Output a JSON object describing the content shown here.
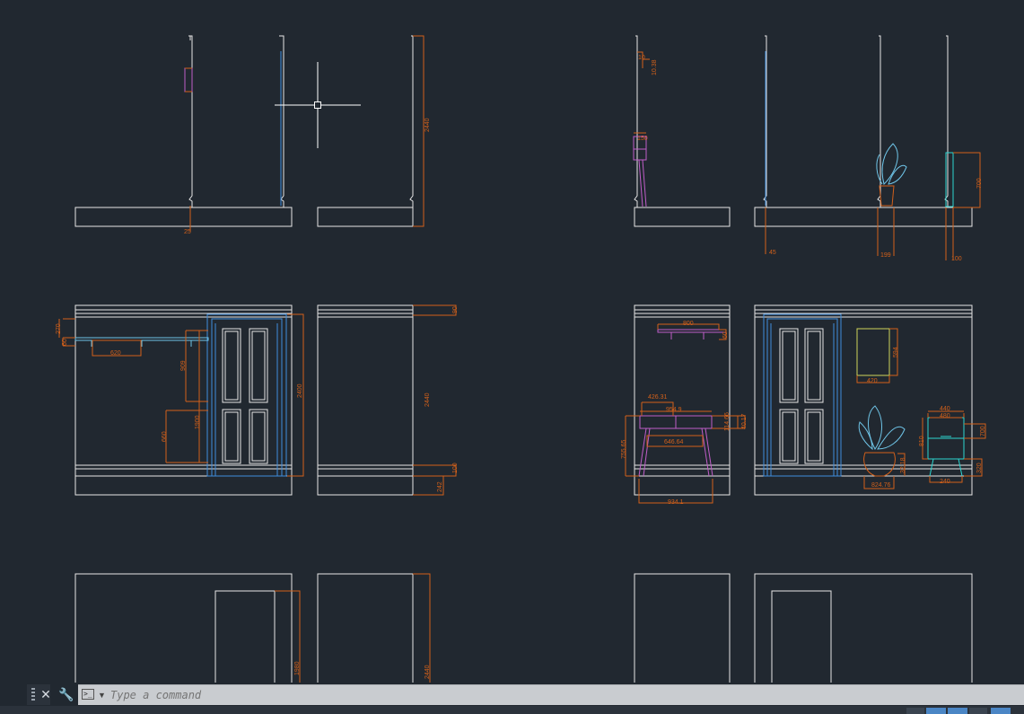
{
  "colors": {
    "background": "#212830",
    "wall_lines": "#e6e6e6",
    "dimensions": "#d2601a",
    "door": "#3e8ede",
    "furniture": "#c05ec8",
    "plant": "#6fc5e8",
    "cabinet": "#2dd6d0",
    "picture": "#cfd55a"
  },
  "dimensions": {
    "top_left": {
      "height": "2440",
      "base": "25"
    },
    "top_right": {
      "h150": "150",
      "h45": "45",
      "h199": "199",
      "h100": "100",
      "h700": "700",
      "s10": "10",
      "s1038": "10.38"
    },
    "mid_left": {
      "d270": "270",
      "d60": "60",
      "d620": "620",
      "d909": "909",
      "d1900": "1900",
      "d660": "660",
      "d2400": "2400",
      "d2440": "2440",
      "d90": "90",
      "d100": "100",
      "d242": "242"
    },
    "mid_right": {
      "d800": "800",
      "d60": "60",
      "d4263": "426.31",
      "d9549": "954.9",
      "d11466": "114.66",
      "d4017": "40.17",
      "d7556": "755.65",
      "d64664": "646.64",
      "d9341": "934.1",
      "d594": "594",
      "d420": "420",
      "d440": "440",
      "d480": "480",
      "d810": "810",
      "d700": "700",
      "d320": "320",
      "d240": "240",
      "d3218": "32.18",
      "d82476": "824.76"
    },
    "bottom_left": {
      "d1980": "1980",
      "d2440": "2440"
    }
  },
  "command_line": {
    "placeholder": "Type a command"
  },
  "icons": [
    "grip-handle-icon",
    "close-icon",
    "customize-wrench-icon",
    "command-prompt-icon",
    "dropdown-arrow-icon",
    "crosshair-cursor"
  ]
}
